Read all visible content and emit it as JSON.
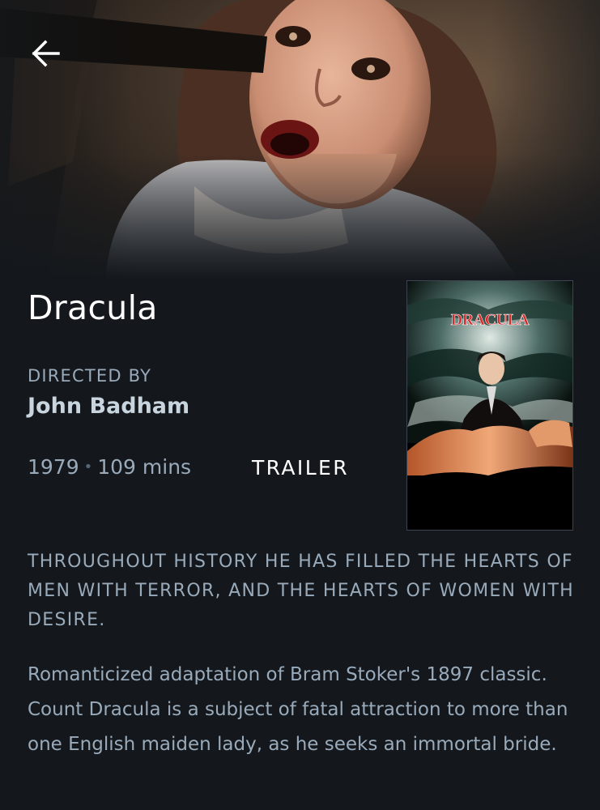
{
  "film": {
    "title": "Dracula",
    "directed_by_label": "DIRECTED BY",
    "director": "John Badham",
    "year": "1979",
    "runtime": "109 mins",
    "trailer_label": "TRAILER",
    "tagline": "THROUGHOUT HISTORY HE HAS FILLED THE HEARTS OF MEN WITH TERROR, AND THE HEARTS OF WOMEN WITH DESIRE.",
    "synopsis": "Romanticized adaptation of Bram Stoker's 1897 classic. Count Dracula is a subject of fatal attraction to more than one English maiden lady, as he seeks an immortal bride."
  },
  "poster": {
    "title_text": "DRACULA"
  },
  "icons": {
    "back": "arrow-left-icon"
  },
  "colors": {
    "background": "#14181c",
    "muted_text": "#99aabb",
    "director_text": "#c8d4de",
    "title_text": "#ffffff",
    "poster_title": "#d42a2a"
  }
}
